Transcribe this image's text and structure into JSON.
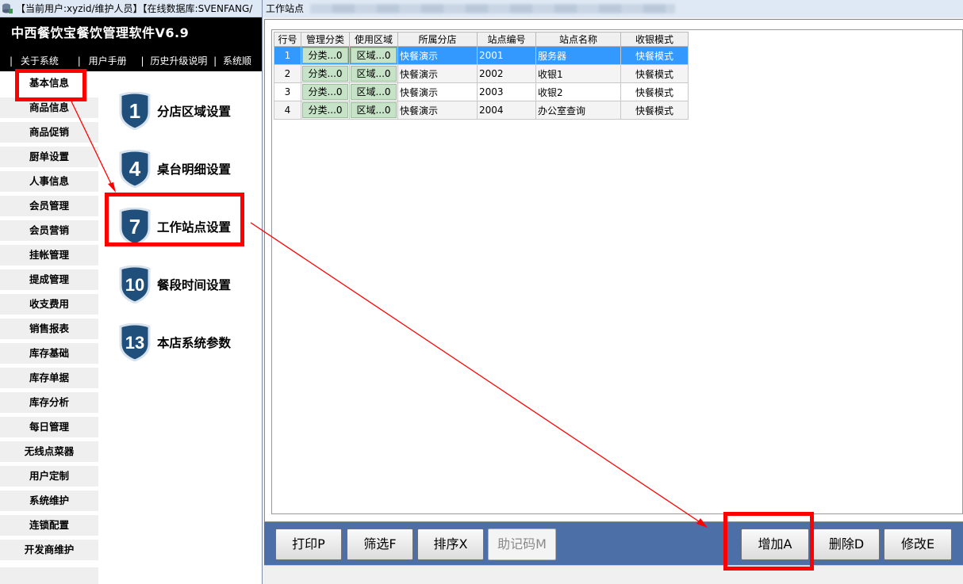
{
  "app_titlebar": {
    "text": "【当前用户:xyzid/维护人员】【在线数据库:SVENFANG/"
  },
  "header": {
    "product_name": "中西餐饮宝餐饮管理软件V6.9",
    "menu": [
      "关于系统",
      "用户手册",
      "历史升级说明",
      "系统顺"
    ]
  },
  "sidebar": {
    "items": [
      "基本信息",
      "商品信息",
      "商品促销",
      "厨单设置",
      "人事信息",
      "会员管理",
      "会员营销",
      "挂帐管理",
      "提成管理",
      "收支费用",
      "销售报表",
      "库存基础",
      "库存单据",
      "库存分析",
      "每日管理",
      "无线点菜器",
      "用户定制",
      "系统维护",
      "连锁配置",
      "开发商维护"
    ]
  },
  "submenu": {
    "items": [
      {
        "number": "1",
        "label": "分店区域设置"
      },
      {
        "number": "4",
        "label": "桌台明细设置"
      },
      {
        "number": "7",
        "label": "工作站点设置"
      },
      {
        "number": "10",
        "label": "餐段时间设置"
      },
      {
        "number": "13",
        "label": "本店系统参数"
      }
    ]
  },
  "window": {
    "title": "工作站点",
    "table": {
      "columns": [
        "行号",
        "管理分类",
        "使用区域",
        "所属分店",
        "站点编号",
        "站点名称",
        "收银模式"
      ],
      "rows": [
        {
          "row": "1",
          "category": "分类...0",
          "area": "区域...0",
          "branch": "快餐演示",
          "code": "2001",
          "name": "服务器",
          "mode": "快餐模式"
        },
        {
          "row": "2",
          "category": "分类...0",
          "area": "区域...0",
          "branch": "快餐演示",
          "code": "2002",
          "name": "收银1",
          "mode": "快餐模式"
        },
        {
          "row": "3",
          "category": "分类...0",
          "area": "区域...0",
          "branch": "快餐演示",
          "code": "2003",
          "name": "收银2",
          "mode": "快餐模式"
        },
        {
          "row": "4",
          "category": "分类...0",
          "area": "区域...0",
          "branch": "快餐演示",
          "code": "2004",
          "name": "办公室查询",
          "mode": "快餐模式"
        }
      ]
    },
    "buttons": {
      "print": "打印P",
      "filter": "筛选F",
      "sort": "排序X",
      "mnemonic": "助记码M",
      "add": "增加A",
      "delete": "删除D",
      "modify": "修改E"
    }
  },
  "colors": {
    "highlight": "#ff0000",
    "selected_row": "#3399ff",
    "button_bar": "#4b6fa6",
    "shield": "#1f4f7a"
  },
  "icons": {
    "app_icon": "database-icon",
    "shield": "shield-number-icon"
  }
}
